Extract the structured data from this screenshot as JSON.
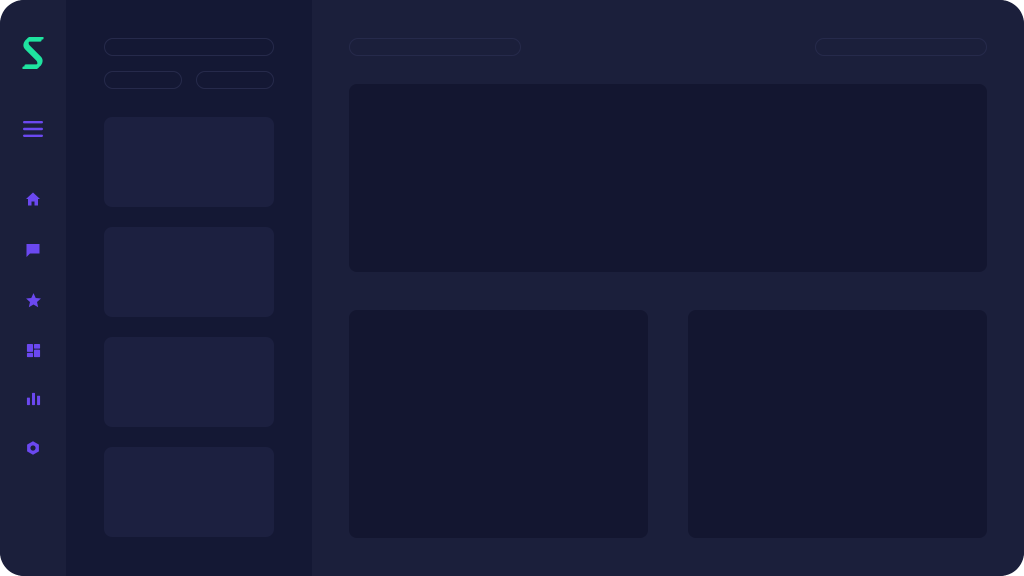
{
  "app": {
    "accent_color": "#6b48f0",
    "logo_color": "#1fe3a0",
    "theme_background": "#1b1f3b"
  },
  "rail": {
    "logo": {
      "icon": "brand-s-logo-icon"
    },
    "menu": {
      "icon": "hamburger-menu-icon"
    },
    "items": [
      {
        "icon": "home-icon"
      },
      {
        "icon": "chat-icon"
      },
      {
        "icon": "star-icon"
      },
      {
        "icon": "dashboard-icon"
      },
      {
        "icon": "bar-chart-icon"
      },
      {
        "icon": "settings-icon"
      }
    ]
  },
  "panel": {
    "search": {
      "value": "",
      "placeholder": ""
    },
    "filters": [
      {
        "label": ""
      },
      {
        "label": ""
      }
    ],
    "cards": [
      {
        "label": ""
      },
      {
        "label": ""
      },
      {
        "label": ""
      },
      {
        "label": ""
      }
    ]
  },
  "main": {
    "header": {
      "title": "",
      "action_label": ""
    },
    "blocks": [
      {
        "label": ""
      },
      {
        "label": ""
      },
      {
        "label": ""
      }
    ]
  }
}
